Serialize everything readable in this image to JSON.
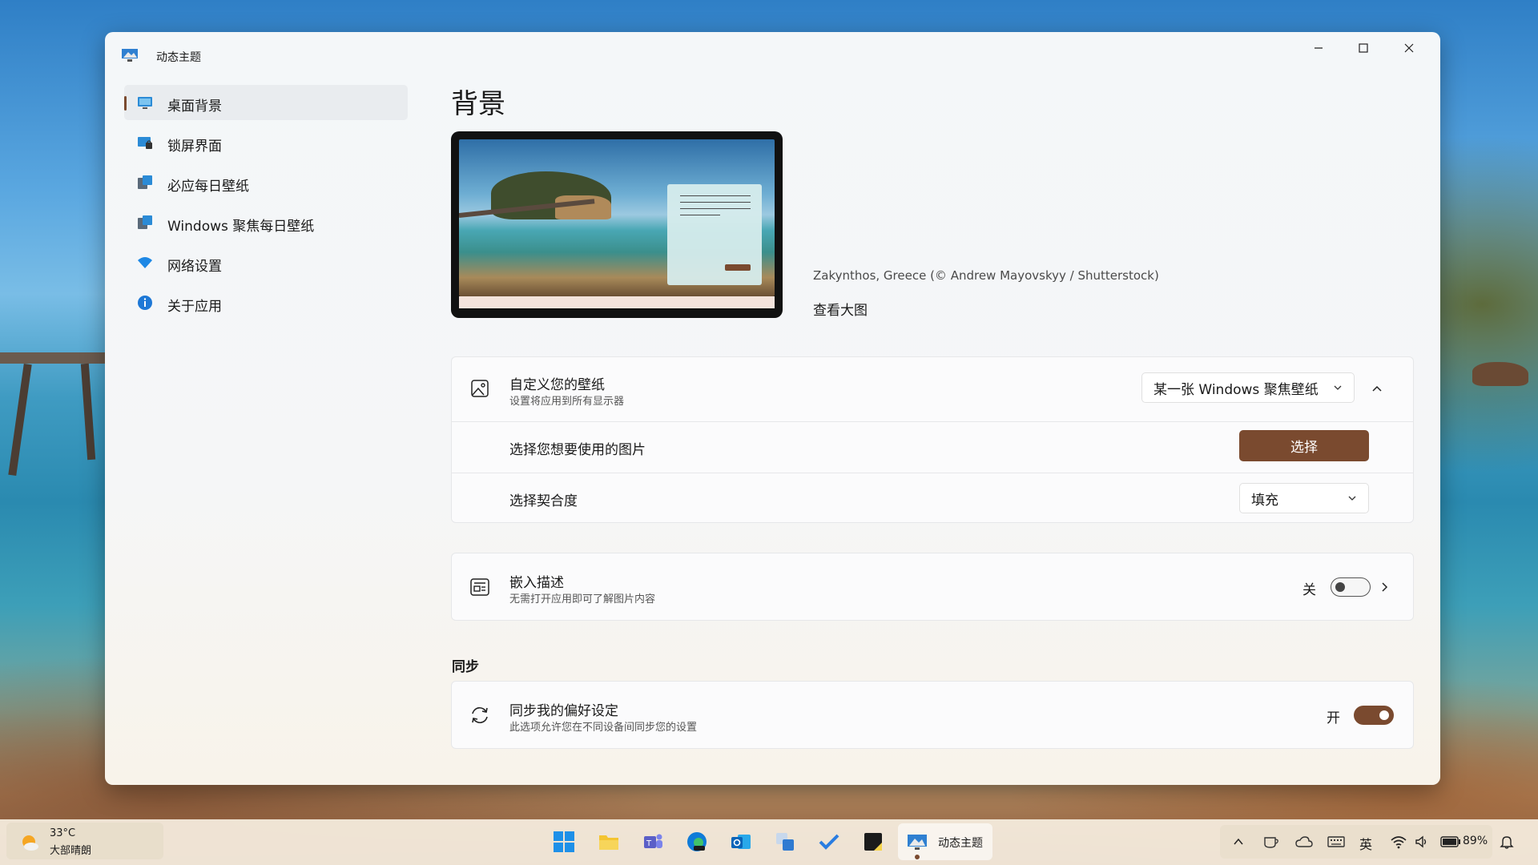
{
  "window": {
    "title": "动态主题"
  },
  "sidebar": {
    "items": [
      {
        "label": "桌面背景",
        "icon": "desktop-icon",
        "selected": true
      },
      {
        "label": "锁屏界面",
        "icon": "lock-screen-icon"
      },
      {
        "label": "必应每日壁纸",
        "icon": "bing-wallpaper-icon"
      },
      {
        "label": "Windows 聚焦每日壁纸",
        "icon": "spotlight-wallpaper-icon"
      },
      {
        "label": "网络设置",
        "icon": "wifi-icon"
      },
      {
        "label": "关于应用",
        "icon": "info-icon"
      }
    ]
  },
  "main": {
    "title": "背景",
    "image_caption": "Zakynthos, Greece (© Andrew Mayovskyy / Shutterstock)",
    "view_large_label": "查看大图",
    "customize": {
      "title": "自定义您的壁纸",
      "subtitle": "设置将应用到所有显示器",
      "dropdown_value": "某一张 Windows 聚焦壁纸",
      "choose_picture_label": "选择您想要使用的图片",
      "choose_button": "选择",
      "fit_label": "选择契合度",
      "fit_value": "填充"
    },
    "embed": {
      "title": "嵌入描述",
      "subtitle": "无需打开应用即可了解图片内容",
      "toggle_label": "关",
      "toggle_on": false
    },
    "sync_section_title": "同步",
    "sync": {
      "title": "同步我的偏好设定",
      "subtitle": "此选项允许您在不同设备间同步您的设置",
      "toggle_label": "开",
      "toggle_on": true
    }
  },
  "taskbar": {
    "weather": {
      "temp": "33°C",
      "desc": "大部晴朗"
    },
    "active_app_label": "动态主题",
    "tray": {
      "ime": "英",
      "battery": "89%"
    }
  },
  "colors": {
    "accent": "#7a4a2f"
  }
}
